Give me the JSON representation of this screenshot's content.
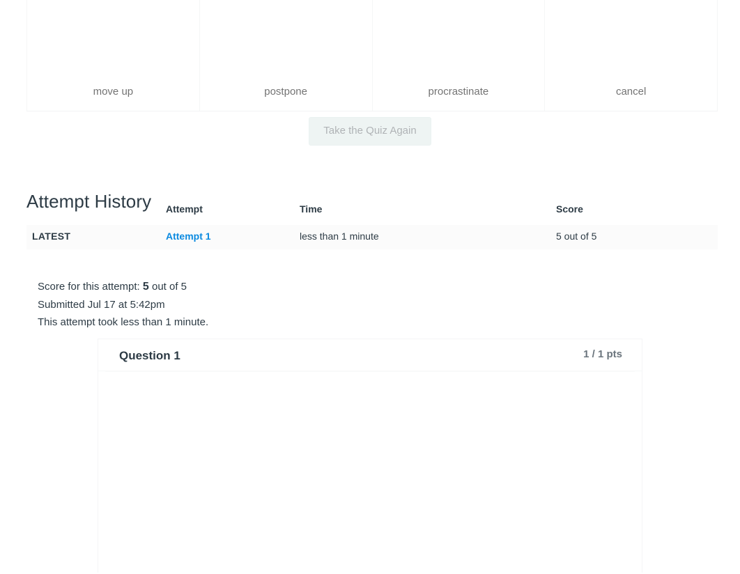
{
  "answer_matrix": {
    "options": [
      {
        "label": "move up"
      },
      {
        "label": "postpone"
      },
      {
        "label": "procrastinate"
      },
      {
        "label": "cancel"
      }
    ]
  },
  "retake": {
    "label": "Take the Quiz Again"
  },
  "attempt_history": {
    "heading": "Attempt History",
    "columns": {
      "blank": "",
      "attempt": "Attempt",
      "time": "Time",
      "score": "Score"
    },
    "rows": [
      {
        "latest_badge": "LATEST",
        "attempt_link": "Attempt 1",
        "time": "less than 1 minute",
        "score": "5 out of 5"
      }
    ]
  },
  "attempt_summary": {
    "score_prefix": "Score for this attempt: ",
    "score_value": "5",
    "score_suffix": " out of 5",
    "submitted": "Submitted Jul 17 at 5:42pm",
    "duration": "This attempt took less than 1 minute."
  },
  "question": {
    "name": "Question 1",
    "points": "1 / 1 pts",
    "body": ""
  },
  "colors": {
    "link_blue": "#0b8ae0",
    "text": "#2d3b45",
    "points_gray": "#6b757d",
    "disabled_button_bg": "#edf4f3",
    "disabled_button_text": "#aaadb0"
  }
}
